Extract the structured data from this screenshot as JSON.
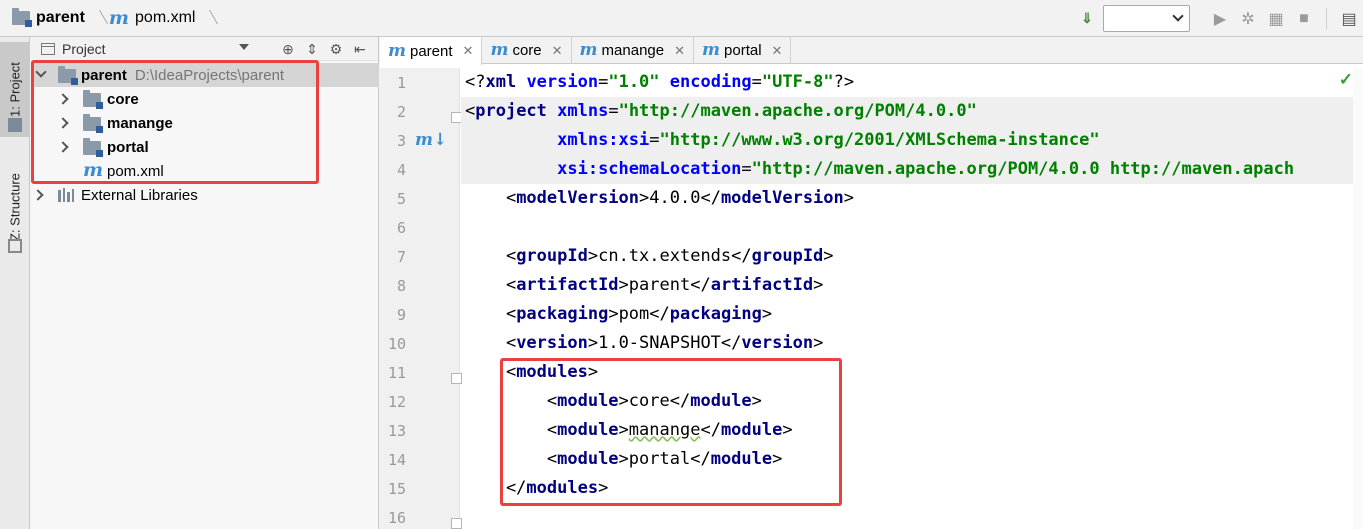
{
  "breadcrumb": {
    "project": "parent",
    "file": "pom.xml"
  },
  "toolbar": {
    "run_config_value": "",
    "icons": [
      "build-icon",
      "run-icon",
      "debug-icon",
      "coverage-icon",
      "stop-icon",
      "project-structure-icon"
    ]
  },
  "tool_strip": {
    "project_tab": "1: Project",
    "structure_tab": "Z: Structure"
  },
  "project_panel": {
    "title": "Project",
    "root": {
      "name": "parent",
      "path": "D:\\IdeaProjects\\parent"
    },
    "children": [
      {
        "name": "core",
        "type": "module"
      },
      {
        "name": "manange",
        "type": "module"
      },
      {
        "name": "portal",
        "type": "module"
      }
    ],
    "file": "pom.xml",
    "external": "External Libraries"
  },
  "editor": {
    "tabs": [
      {
        "label": "parent",
        "active": true
      },
      {
        "label": "core",
        "active": false
      },
      {
        "label": "manange",
        "active": false
      },
      {
        "label": "portal",
        "active": false
      }
    ],
    "line_numbers": [
      "1",
      "2",
      "3",
      "4",
      "5",
      "6",
      "7",
      "8",
      "9",
      "10",
      "11",
      "12",
      "13",
      "14",
      "15",
      "16"
    ],
    "code": {
      "l1": {
        "a": "<?",
        "b": "xml ",
        "c": "version",
        "d": "=",
        "e": "\"1.0\"",
        "f": " ",
        "g": "encoding",
        "h": "=",
        "i": "\"UTF-8\"",
        "j": "?>"
      },
      "l2": {
        "a": "<",
        "b": "project ",
        "c": "xmlns",
        "d": "=",
        "e": "\"http://maven.apache.org/POM/4.0.0\""
      },
      "l3": {
        "c": "xmlns:xsi",
        "d": "=",
        "e": "\"http://www.w3.org/2001/XMLSchema-instance\""
      },
      "l4": {
        "c": "xsi:schemaLocation",
        "d": "=",
        "e": "\"http://maven.apache.org/POM/4.0.0 http://maven.apach"
      },
      "l5": {
        "tag": "modelVersion",
        "text": "4.0.0"
      },
      "l7": {
        "tag": "groupId",
        "text": "cn.tx.extends"
      },
      "l8": {
        "tag": "artifactId",
        "text": "parent"
      },
      "l9": {
        "tag": "packaging",
        "text": "pom"
      },
      "l10": {
        "tag": "version",
        "text": "1.0-SNAPSHOT"
      },
      "l11": {
        "tag": "modules"
      },
      "l12": {
        "tag": "module",
        "text": "core"
      },
      "l13": {
        "tag": "module",
        "text": "manange"
      },
      "l14": {
        "tag": "module",
        "text": "portal"
      },
      "l15": {
        "tag": "modules"
      }
    },
    "accent_colors": {
      "tag": "#000080",
      "attr": "#0000ff",
      "value": "#008000",
      "annotation": "#e8413f",
      "maven": "#3c8dd0"
    }
  }
}
